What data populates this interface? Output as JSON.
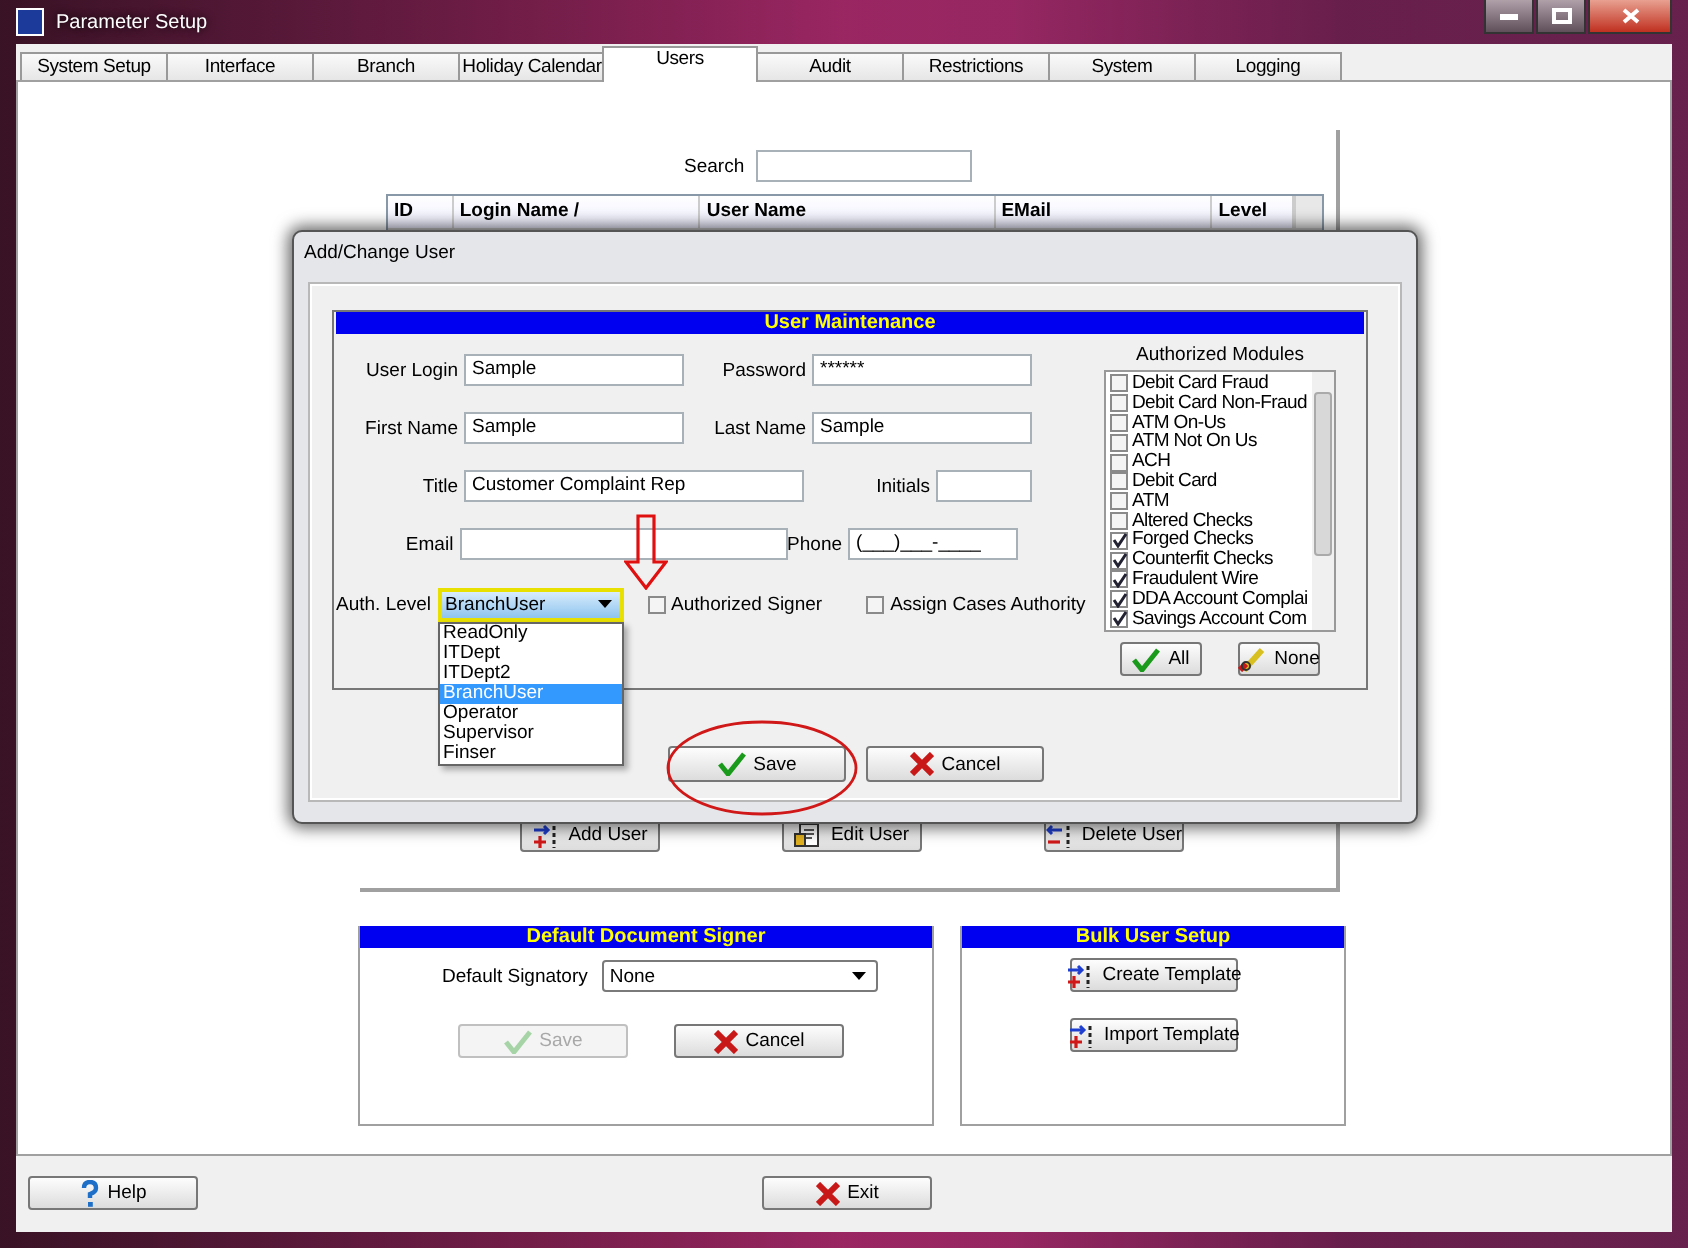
{
  "window": {
    "title": "Parameter Setup"
  },
  "tabs": [
    {
      "label": "System Setup",
      "selected": false
    },
    {
      "label": "Interface",
      "selected": false
    },
    {
      "label": "Branch",
      "selected": false
    },
    {
      "label": "Holiday Calendar",
      "selected": false
    },
    {
      "label": "Users",
      "selected": true
    },
    {
      "label": "Audit",
      "selected": false
    },
    {
      "label": "Restrictions",
      "selected": false
    },
    {
      "label": "System",
      "selected": false
    },
    {
      "label": "Logging",
      "selected": false
    }
  ],
  "search": {
    "label": "Search"
  },
  "users_table": {
    "columns": [
      "ID",
      "Login Name /",
      "User Name",
      "EMail",
      "Level"
    ]
  },
  "user_buttons": [
    {
      "label": "Add User"
    },
    {
      "label": "Edit User"
    },
    {
      "label": "Delete User"
    }
  ],
  "default_document_signer": {
    "title": "Default Document Signer",
    "signatory_label": "Default Signatory",
    "signatory_value": "None",
    "buttons": [
      {
        "label": "Save",
        "disabled": true
      },
      {
        "label": "Cancel",
        "disabled": false
      }
    ]
  },
  "bulk_user_setup": {
    "title": "Bulk User Setup",
    "buttons": [
      {
        "label": "Create Template"
      },
      {
        "label": "Import Template"
      }
    ]
  },
  "footer_buttons": [
    {
      "label": "Help"
    },
    {
      "label": "Exit"
    }
  ],
  "dialog": {
    "title": "Add/Change User",
    "section_title": "User Maintenance",
    "rows": [
      {
        "left": {
          "label": "User Login",
          "value": "Sample"
        },
        "right": {
          "label": "Password",
          "value": "******"
        }
      },
      {
        "left": {
          "label": "First Name",
          "value": "Sample"
        },
        "right": {
          "label": "Last Name",
          "value": "Sample"
        }
      },
      {
        "left": {
          "label": "Title",
          "value": "Customer Complaint Rep"
        },
        "right": {
          "label": "Initials"
        }
      },
      {
        "left": {
          "label": "Email"
        },
        "right": {
          "label": "Phone",
          "value": "(___)___-____"
        }
      }
    ],
    "auth_level": {
      "label": "Auth. Level",
      "value": "BranchUser",
      "expanded": true,
      "options": [
        {
          "label": "ReadOnly",
          "selected": false
        },
        {
          "label": "ITDept",
          "selected": false
        },
        {
          "label": "ITDept2",
          "selected": false
        },
        {
          "label": "BranchUser",
          "selected": true
        },
        {
          "label": "Operator",
          "selected": false
        },
        {
          "label": "Supervisor",
          "selected": false
        },
        {
          "label": "Finser",
          "selected": false
        }
      ]
    },
    "checkboxes": [
      {
        "label": "Authorized Signer",
        "checked": false
      },
      {
        "label": "Assign Cases Authority",
        "checked": false
      }
    ],
    "modules": {
      "title": "Authorized Modules",
      "items": [
        {
          "label": "Debit Card Fraud",
          "checked": false
        },
        {
          "label": "Debit Card Non-Fraud",
          "checked": false
        },
        {
          "label": "ATM On-Us",
          "checked": false
        },
        {
          "label": "ATM Not On Us",
          "checked": false
        },
        {
          "label": "ACH",
          "checked": false
        },
        {
          "label": "Debit Card",
          "checked": false
        },
        {
          "label": "ATM",
          "checked": false
        },
        {
          "label": "Altered Checks",
          "checked": false
        },
        {
          "label": "Forged Checks",
          "checked": true
        },
        {
          "label": "Counterfit Checks",
          "checked": true
        },
        {
          "label": "Fraudulent Wire",
          "checked": true
        },
        {
          "label": "DDA Account Complai",
          "checked": true
        },
        {
          "label": "Savings Account Com",
          "checked": true
        }
      ],
      "buttons": [
        {
          "label": "All"
        },
        {
          "label": "None"
        }
      ]
    },
    "buttons": [
      {
        "label": "Save"
      },
      {
        "label": "Cancel"
      }
    ]
  }
}
